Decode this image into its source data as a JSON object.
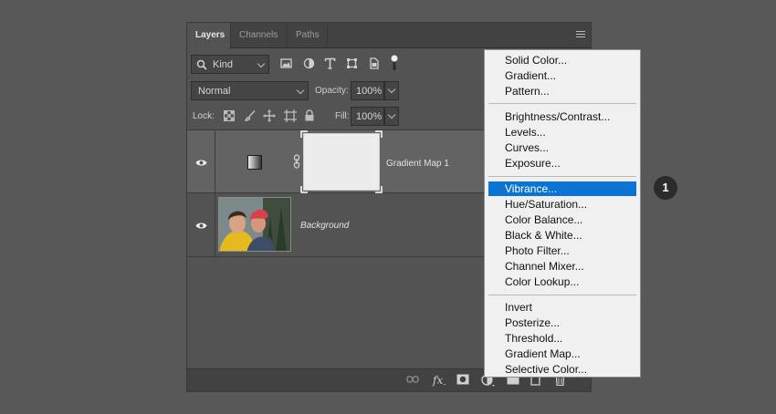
{
  "tabs": [
    {
      "label": "Layers",
      "active": true
    },
    {
      "label": "Channels",
      "active": false
    },
    {
      "label": "Paths",
      "active": false
    }
  ],
  "filter": {
    "kind_label": "Kind"
  },
  "blend": {
    "mode": "Normal",
    "opacity_label": "Opacity:",
    "opacity_value": "100%"
  },
  "lock": {
    "label": "Lock:",
    "fill_label": "Fill:",
    "fill_value": "100%"
  },
  "layers": [
    {
      "name": "Gradient Map 1",
      "type": "adjustment",
      "visible": true,
      "selected": true
    },
    {
      "name": "Background",
      "type": "image",
      "visible": true,
      "selected": false
    }
  ],
  "menu": {
    "groups": [
      [
        "Solid Color...",
        "Gradient...",
        "Pattern..."
      ],
      [
        "Brightness/Contrast...",
        "Levels...",
        "Curves...",
        "Exposure..."
      ],
      [
        "Vibrance...",
        "Hue/Saturation...",
        "Color Balance...",
        "Black & White...",
        "Photo Filter...",
        "Channel Mixer...",
        "Color Lookup..."
      ],
      [
        "Invert",
        "Posterize...",
        "Threshold...",
        "Gradient Map...",
        "Selective Color..."
      ]
    ],
    "highlighted": "Vibrance..."
  },
  "step_badge": "1",
  "colors": {
    "highlight": "#0a74d4",
    "panel_bg": "#535353",
    "selected_layer_bg": "#636363"
  }
}
